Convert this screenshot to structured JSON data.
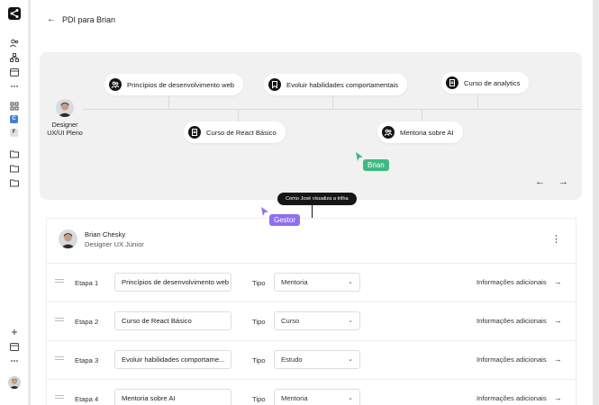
{
  "header": {
    "back_icon": "arrow-left-icon",
    "title": "PDI para Brian"
  },
  "sidebar": {
    "logo": "share-logo-icon",
    "icons": [
      "users-icon",
      "hierarchy-icon",
      "calendar-icon",
      "more-icon",
      "grid-icon"
    ],
    "badges": [
      {
        "letter": "C",
        "color": "#3f7fe0"
      },
      {
        "letter": "F",
        "color": "#e0e0e0"
      }
    ],
    "folders": [
      "folder-icon",
      "folder-icon",
      "folder-icon"
    ],
    "bottom_icons": [
      "plus-icon",
      "calendar-icon",
      "more-icon"
    ]
  },
  "trail": {
    "designer": {
      "line1": "Designer",
      "line2": "UX/UI Pleno"
    },
    "nodes": [
      {
        "label": "Princípios de desenvolvimento web",
        "icon": "people-icon"
      },
      {
        "label": "Evoluir habilidades comportamentais",
        "icon": "bookmark-icon"
      },
      {
        "label": "Curso de analytics",
        "icon": "document-icon"
      },
      {
        "label": "Curso de React Básico",
        "icon": "document-icon"
      },
      {
        "label": "Mentoria sobre AI",
        "icon": "people-icon"
      }
    ],
    "prev": "←",
    "next": "→"
  },
  "cursors": {
    "brian": {
      "label": "Brian",
      "color": "#3fb984"
    },
    "gestor": {
      "label": "Gestor",
      "color": "#8f6ff0"
    }
  },
  "tooltip": "Como José visualiza a trilha",
  "profile": {
    "name": "Brian Chesky",
    "role": "Designer UX Júnior",
    "menu": "⋮"
  },
  "steps": [
    {
      "stage": "Etapa 1",
      "name": "Princípios de desenvolvimento web",
      "tipo_label": "Tipo",
      "tipo": "Mentoria",
      "info": "Informações adicionais"
    },
    {
      "stage": "Etapa 2",
      "name": "Curso de React Básico",
      "tipo_label": "Tipo",
      "tipo": "Curso",
      "info": "Informações adicionais"
    },
    {
      "stage": "Etapa 3",
      "name": "Evoluir habilidades comportame...",
      "tipo_label": "Tipo",
      "tipo": "Estudo",
      "info": "Informações adicionais"
    },
    {
      "stage": "Etapa 4",
      "name": "Mentoria sobre AI",
      "tipo_label": "Tipo",
      "tipo": "Mentoria",
      "info": "Informações adicionais"
    }
  ]
}
